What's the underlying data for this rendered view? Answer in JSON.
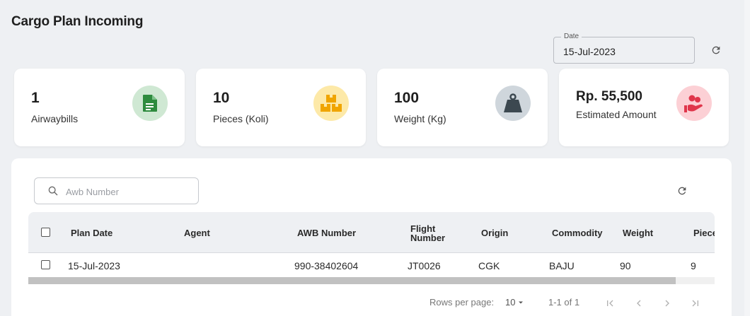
{
  "page": {
    "title": "Cargo Plan Incoming"
  },
  "date_filter": {
    "legend": "Date",
    "value": "15-Jul-2023"
  },
  "summary_cards": [
    {
      "value": "1",
      "label": "Airwaybills",
      "icon": "document-icon",
      "icon_color": "#2e8b3e",
      "bg_color": "#cfe8d3"
    },
    {
      "value": "10",
      "label": "Pieces (Koli)",
      "icon": "boxes-icon",
      "icon_color": "#f0a500",
      "bg_color": "#fde9a8"
    },
    {
      "value": "100",
      "label": "Weight (Kg)",
      "icon": "weight-icon",
      "icon_color": "#3c4850",
      "bg_color": "#cfd6dc"
    },
    {
      "value": "Rp. 55,500",
      "label": "Estimated Amount",
      "icon": "money-hand-icon",
      "icon_color": "#e0364b",
      "bg_color": "#fcd0d5"
    }
  ],
  "search": {
    "placeholder": "Awb Number",
    "value": ""
  },
  "table": {
    "columns": [
      "Plan Date",
      "Agent",
      "AWB Number",
      "Flight\nNumber",
      "Origin",
      "Commodity",
      "Weight",
      "Pieces"
    ],
    "rows": [
      {
        "plan_date": "15-Jul-2023",
        "agent": "",
        "awb_number": "990-38402604",
        "flight_number": "JT0026",
        "origin": "CGK",
        "commodity": "BAJU",
        "weight": "90",
        "pieces": "9"
      }
    ]
  },
  "pagination": {
    "rows_per_page_label": "Rows per page:",
    "rows_per_page": "10",
    "range": "1-1 of 1"
  },
  "colors": {
    "background": "#eef0f3",
    "panel": "#ffffff",
    "header_bg": "#eef0f3"
  }
}
